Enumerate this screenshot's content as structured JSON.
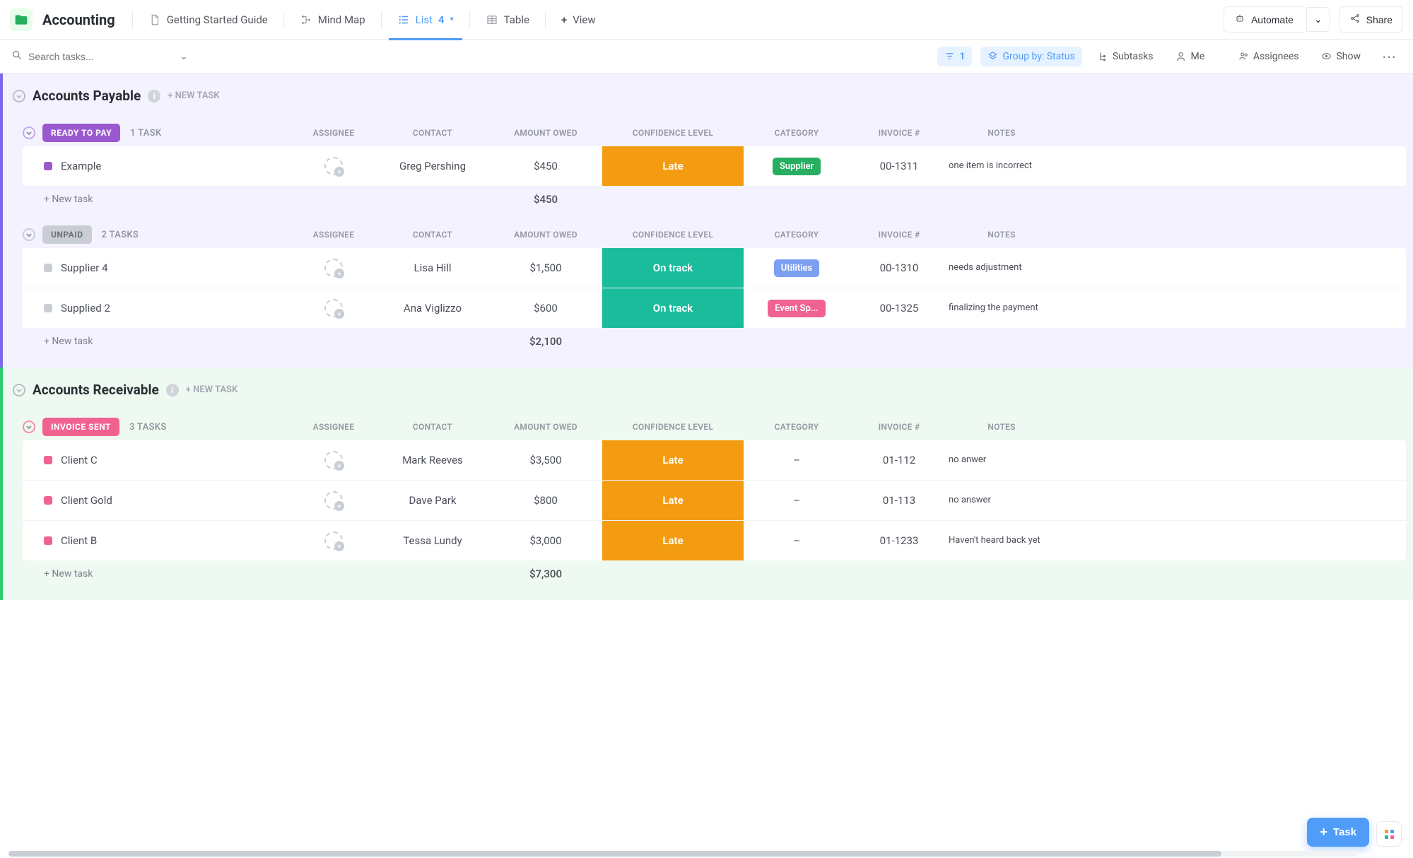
{
  "header": {
    "title": "Accounting",
    "tabs": [
      {
        "label": "Getting Started Guide"
      },
      {
        "label": "Mind Map"
      },
      {
        "label": "List",
        "count": "4"
      },
      {
        "label": "Table"
      },
      {
        "label": "View"
      }
    ],
    "automate": "Automate",
    "share": "Share"
  },
  "filters": {
    "search_placeholder": "Search tasks...",
    "filter_count": "1",
    "group_by": "Group by: Status",
    "subtasks": "Subtasks",
    "me": "Me",
    "assignees": "Assignees",
    "show": "Show"
  },
  "columns": {
    "assignee": "ASSIGNEE",
    "contact": "CONTACT",
    "amount": "AMOUNT OWED",
    "confidence": "CONFIDENCE LEVEL",
    "category": "CATEGORY",
    "invoice": "INVOICE #",
    "notes": "NOTES"
  },
  "sections": [
    {
      "name": "Accounts Payable",
      "color": "purple",
      "new_task": "+ NEW TASK",
      "groups": [
        {
          "status": "READY TO PAY",
          "pill": "pill-purple",
          "toggle": "",
          "count": "1 TASK",
          "rows": [
            {
              "sq": "purple",
              "name": "Example",
              "contact": "Greg Pershing",
              "amount": "$450",
              "confidence": "Late",
              "conf_cls": "late",
              "category": "Supplier",
              "cat_cls": "tag-green",
              "invoice": "00-1311",
              "notes": "one item is incorrect"
            }
          ],
          "total": "$450",
          "new_task": "+ New task"
        },
        {
          "status": "UNPAID",
          "pill": "pill-gray",
          "toggle": "gray",
          "count": "2 TASKS",
          "rows": [
            {
              "sq": "gray",
              "name": "Supplier 4",
              "contact": "Lisa Hill",
              "amount": "$1,500",
              "confidence": "On track",
              "conf_cls": "ontrack",
              "category": "Utilities",
              "cat_cls": "tag-blue",
              "invoice": "00-1310",
              "notes": "needs adjustment"
            },
            {
              "sq": "gray",
              "name": "Supplied 2",
              "contact": "Ana Viglizzo",
              "amount": "$600",
              "confidence": "On track",
              "conf_cls": "ontrack",
              "category": "Event Sp...",
              "cat_cls": "tag-pink",
              "invoice": "00-1325",
              "notes": "finalizing the payment"
            }
          ],
          "total": "$2,100",
          "new_task": "+ New task"
        }
      ]
    },
    {
      "name": "Accounts Receivable",
      "color": "green",
      "new_task": "+ NEW TASK",
      "groups": [
        {
          "status": "INVOICE SENT",
          "pill": "pill-pink",
          "toggle": "pink",
          "count": "3 TASKS",
          "rows": [
            {
              "sq": "pink",
              "name": "Client C",
              "contact": "Mark Reeves",
              "amount": "$3,500",
              "confidence": "Late",
              "conf_cls": "late",
              "category": "–",
              "cat_cls": "",
              "invoice": "01-112",
              "notes": "no anwer"
            },
            {
              "sq": "pink",
              "name": "Client Gold",
              "contact": "Dave Park",
              "amount": "$800",
              "confidence": "Late",
              "conf_cls": "late",
              "category": "–",
              "cat_cls": "",
              "invoice": "01-113",
              "notes": "no answer"
            },
            {
              "sq": "pink",
              "name": "Client B",
              "contact": "Tessa Lundy",
              "amount": "$3,000",
              "confidence": "Late",
              "conf_cls": "late",
              "category": "–",
              "cat_cls": "",
              "invoice": "01-1233",
              "notes": "Haven't heard back yet"
            }
          ],
          "total": "$7,300",
          "new_task": "+ New task"
        }
      ]
    }
  ],
  "float": {
    "task": "Task"
  }
}
